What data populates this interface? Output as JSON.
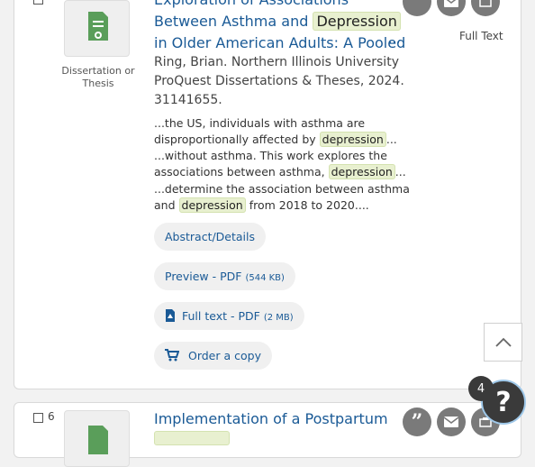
{
  "result1": {
    "type_label": "Dissertation or Thesis",
    "title_line1": "Exploration of Associations",
    "title_line2_pre": "Between Asthma and",
    "title_highlight": "Depression",
    "title_line3": "in Older American Adults: A Pooled",
    "title_more": "...",
    "meta_line1": "Ring, Brian.   Northern Illinois University",
    "meta_line2": "ProQuest Dissertations & Theses,  2024.",
    "meta_line3": "31141655.",
    "snippet1_a": "...the US, individuals with asthma are",
    "snippet1_b": "disproportionally affected by",
    "snippet1_hl": "depression",
    "snippet1_end": "...",
    "snippet2_a": "...without asthma. This work explores the",
    "snippet2_b": "associations between asthma,",
    "snippet2_hl": "depression",
    "snippet2_end": "...",
    "snippet3_a": "...determine the association between asthma",
    "snippet3_b": "and",
    "snippet3_hl": "depression",
    "snippet3_end": "from 2018 to 2020....",
    "abstract_label": "Abstract/Details",
    "preview_label": "Preview - PDF",
    "preview_size": "(544 KB)",
    "fulltext_label": "Full text - PDF",
    "fulltext_size": "(2 MB)",
    "order_label": "Order a copy",
    "full_text_badge": "Full Text"
  },
  "result2": {
    "number": "6",
    "title_line1": "Implementation of a Postpartum"
  },
  "help": {
    "badge_count": "4",
    "symbol": "?"
  },
  "icons": {
    "cite": "quote-icon",
    "email": "email-icon",
    "save": "save-icon",
    "pdf": "pdf-icon",
    "cart": "cart-icon",
    "up": "chevron-up-icon"
  },
  "colors": {
    "link": "#1a5a96",
    "highlight": "#e8f0d0",
    "icon_circle": "#7a7a7a"
  }
}
